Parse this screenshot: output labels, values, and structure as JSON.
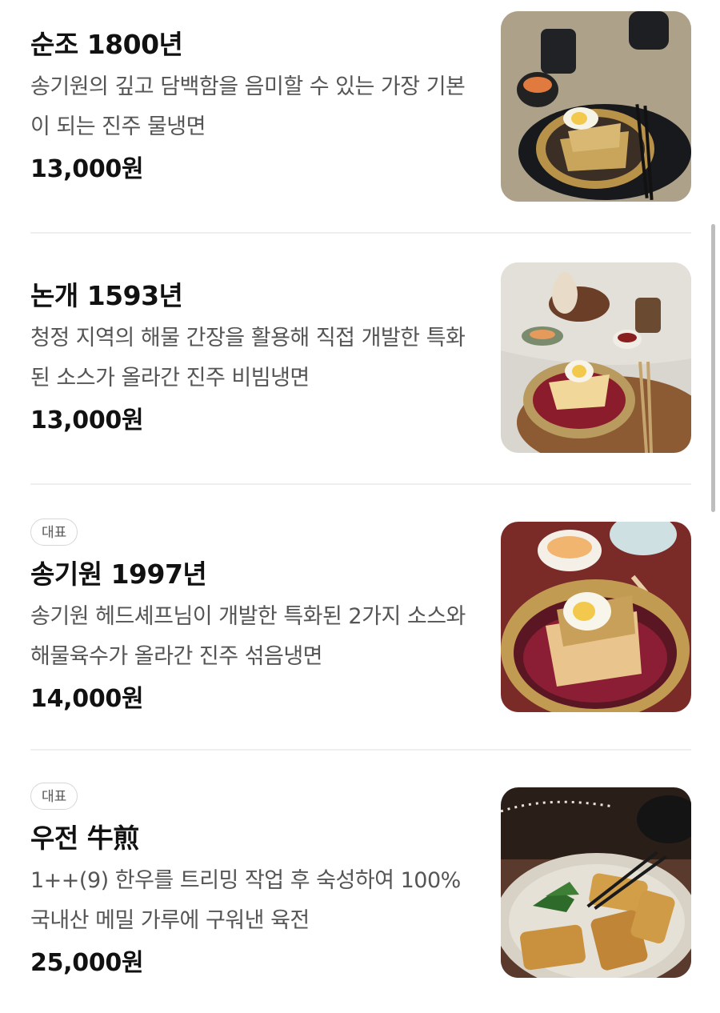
{
  "menu": {
    "items": [
      {
        "badge": "",
        "name": "순조 1800년",
        "desc": "송기원의 깊고 담백함을 음미할 수 있는 가장 기본이 되는 진주 물냉면",
        "price": "13,000원",
        "image": "mul-naengmyeon-photo"
      },
      {
        "badge": "",
        "name": "논개 1593년",
        "desc": "청정 지역의 해물 간장을 활용해 직접 개발한 특화된 소스가 올라간 진주 비빔냉면",
        "price": "13,000원",
        "image": "bibim-naengmyeon-photo"
      },
      {
        "badge": "대표",
        "name": "송기원 1997년",
        "desc": "송기원 헤드셰프님이 개발한 특화된 2가지 소스와 해물육수가 올라간 진주 섞음냉면",
        "price": "14,000원",
        "image": "mixed-naengmyeon-photo"
      },
      {
        "badge": "대표",
        "name": "우전 牛煎",
        "desc": "1++(9) 한우를 트리밍 작업 후 숙성하여 100% 국내산 메밀 가루에 구워낸 육전",
        "price": "25,000원",
        "image": "yukjeon-photo"
      }
    ]
  },
  "colors": {
    "text": "#111111",
    "desc": "#555555",
    "divider": "#efefef",
    "badge_border": "#d6d6d6"
  }
}
